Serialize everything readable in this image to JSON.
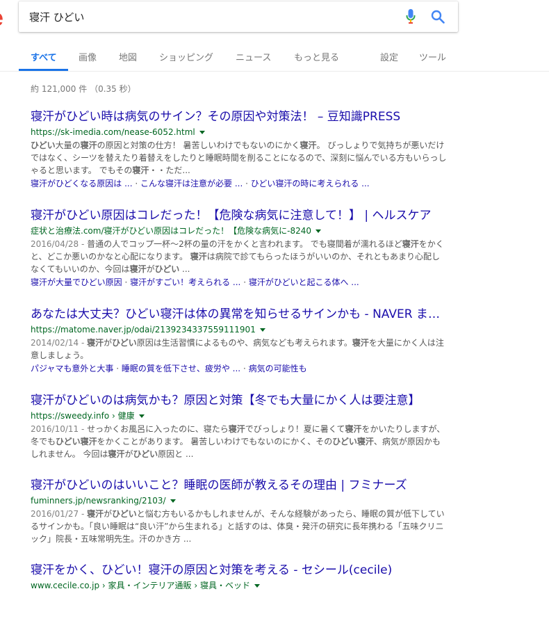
{
  "search": {
    "query": "寝汗 ひどい"
  },
  "tabs": [
    {
      "label": "すべて",
      "active": true
    },
    {
      "label": "画像"
    },
    {
      "label": "地図"
    },
    {
      "label": "ショッピング"
    },
    {
      "label": "ニュース"
    },
    {
      "label": "もっと見る"
    },
    {
      "label": "設定"
    },
    {
      "label": "ツール"
    }
  ],
  "stats": "約 121,000 件 （0.35 秒）",
  "results": [
    {
      "title": "寝汗がひどい時は病気のサイン？その原因や対策法！ – 豆知識PRESS",
      "url": "https://sk-imedia.com/nease-6052.html",
      "snippet": [
        {
          "t": "ひどい",
          "b": true
        },
        {
          "t": "大量の"
        },
        {
          "t": "寝汗",
          "b": true
        },
        {
          "t": "の原因と対策の仕方！ 暑苦しいわけでもないのにかく"
        },
        {
          "t": "寝汗",
          "b": true
        },
        {
          "t": "。 びっしょりで気持ちが悪いだけではなく、シーツを替えたり着替えをしたりと睡眠時間を削ることになるので、深刻に悩んでいる方もいらっしゃると思います。 でもその"
        },
        {
          "t": "寝汗",
          "b": true
        },
        {
          "t": "・・ただ..."
        }
      ],
      "sitelinks": [
        "寝汗がひどくなる原因は ...",
        "こんな寝汗は注意が必要 ...",
        "ひどい寝汗の時に考えられる ..."
      ]
    },
    {
      "title": "寝汗がひどい原因はコレだった！【危険な病気に注意して！】 | ヘルスケア",
      "url": "症状と治療法.com/寝汗がひどい原因はコレだった！【危険な病気に-8240",
      "snippet": [
        {
          "t": "2016/04/28 - ",
          "date": true
        },
        {
          "t": "普通の人でコップ一杯〜2杯の量の汗をかくと言われます。 でも寝間着が濡れるほど"
        },
        {
          "t": "寝汗",
          "b": true
        },
        {
          "t": "をかくと、どこか悪いのかなと心配になります。 "
        },
        {
          "t": "寝汗",
          "b": true
        },
        {
          "t": "は病院で診てもらったほうがいいのか、それともあまり心配しなくてもいいのか、今回は"
        },
        {
          "t": "寝汗",
          "b": true
        },
        {
          "t": "が"
        },
        {
          "t": "ひどい",
          "b": true
        },
        {
          "t": " ..."
        }
      ],
      "sitelinks": [
        "寝汗が大量でひどい原因",
        "寝汗がすごい！考えられる ...",
        "寝汗がひどいと起こる体へ ..."
      ]
    },
    {
      "title": "あなたは大丈夫？ひどい寝汗は体の異常を知らせるサインかも - NAVER まとめ",
      "url": "https://matome.naver.jp/odai/2139234337559111901",
      "snippet": [
        {
          "t": "2014/02/14 - ",
          "date": true
        },
        {
          "t": "寝汗",
          "b": true
        },
        {
          "t": "が"
        },
        {
          "t": "ひどい",
          "b": true
        },
        {
          "t": "原因は生活習慣によるものや、病気なども考えられます。"
        },
        {
          "t": "寝汗",
          "b": true
        },
        {
          "t": "を大量にかく人は注意しましょう。"
        }
      ],
      "sitelinks": [
        "パジャマも意外と大事",
        "睡眠の質を低下させ、疲労や ...",
        "病気の可能性も"
      ]
    },
    {
      "title": "寝汗がひどいのは病気かも？原因と対策【冬でも大量にかく人は要注意】",
      "url": "https://sweedy.info › 健康",
      "snippet": [
        {
          "t": "2016/10/11 - ",
          "date": true
        },
        {
          "t": "せっかくお風呂に入ったのに、寝たら"
        },
        {
          "t": "寝汗",
          "b": true
        },
        {
          "t": "でびっしょり！夏に暑くて"
        },
        {
          "t": "寝汗",
          "b": true
        },
        {
          "t": "をかいたりしますが、冬でも"
        },
        {
          "t": "ひどい寝汗",
          "b": true
        },
        {
          "t": "をかくことがあります。 暑苦しいわけでもないのにかく、その"
        },
        {
          "t": "ひどい寝汗",
          "b": true
        },
        {
          "t": "、病気が原因かもしれません。 今回は"
        },
        {
          "t": "寝汗",
          "b": true
        },
        {
          "t": "が"
        },
        {
          "t": "ひどい",
          "b": true
        },
        {
          "t": "原因と ..."
        }
      ],
      "sitelinks": []
    },
    {
      "title": "寝汗がひどいのはいいこと？睡眠の医師が教えるその理由 | フミナーズ",
      "url": "fuminners.jp/newsranking/2103/",
      "snippet": [
        {
          "t": "2016/01/27 - ",
          "date": true
        },
        {
          "t": "寝汗",
          "b": true
        },
        {
          "t": "が"
        },
        {
          "t": "ひどい",
          "b": true
        },
        {
          "t": "と悩む方もいるかもしれませんが、そんな経験があったら、睡眠の質が低下しているサインかも。「良い睡眠は“良い汗”から生まれる」と話すのは、体臭・発汗の研究に長年携わる「五味クリニック」院長・五味常明先生。汗のかき方 ..."
        }
      ],
      "sitelinks": []
    },
    {
      "title": "寝汗をかく、ひどい！寝汗の原因と対策を考える - セシール(cecile)",
      "url": "www.cecile.co.jp › 家具・インテリア通販 › 寝具・ベッド",
      "snippet": [],
      "sitelinks": []
    }
  ]
}
